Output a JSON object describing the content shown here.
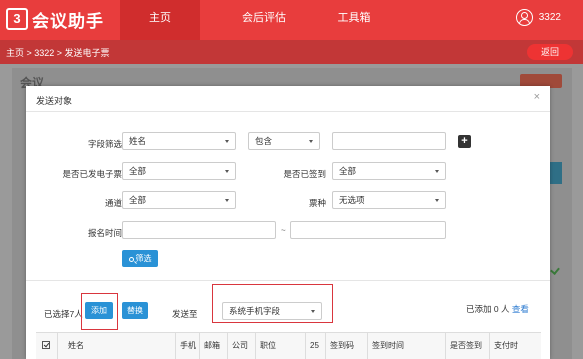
{
  "app": {
    "logo_mark": "3",
    "logo_text": "会议助手"
  },
  "nav": {
    "items": [
      "主页",
      "会后评估",
      "工具箱"
    ]
  },
  "user": {
    "name": "3322"
  },
  "breadcrumb": {
    "text": "主页 > 3322 > 发送电子票",
    "back_label": "返回"
  },
  "background_page": {
    "logo": "会议"
  },
  "modal": {
    "title": "发送对象",
    "close": "×",
    "filter": {
      "field_label": "字段筛选",
      "field_value": "姓名",
      "operator_value": "包含",
      "field_input_value": "",
      "sent_ticket_label": "是否已发电子票",
      "sent_ticket_value": "全部",
      "signed_in_label": "是否已签到",
      "signed_in_value": "全部",
      "channel_label": "通道",
      "channel_value": "全部",
      "ticket_type_label": "票种",
      "ticket_type_value": "无选项",
      "reg_time_label": "报名时间",
      "reg_time_start": "",
      "reg_time_sep": "~",
      "reg_time_end": "",
      "filter_button": "筛选"
    },
    "selection": {
      "selected_text": "已选择7人",
      "add_button": "添加",
      "replace_button": "替换",
      "send_to_label": "发送至",
      "send_to_value": "系统手机字段",
      "added_text": "已添加 0 人",
      "view_link": "查看"
    },
    "table": {
      "headers": [
        "姓名",
        "手机",
        "邮箱",
        "公司",
        "职位",
        "25",
        "签到码",
        "签到时间",
        "是否签到",
        "支付时"
      ]
    }
  }
}
